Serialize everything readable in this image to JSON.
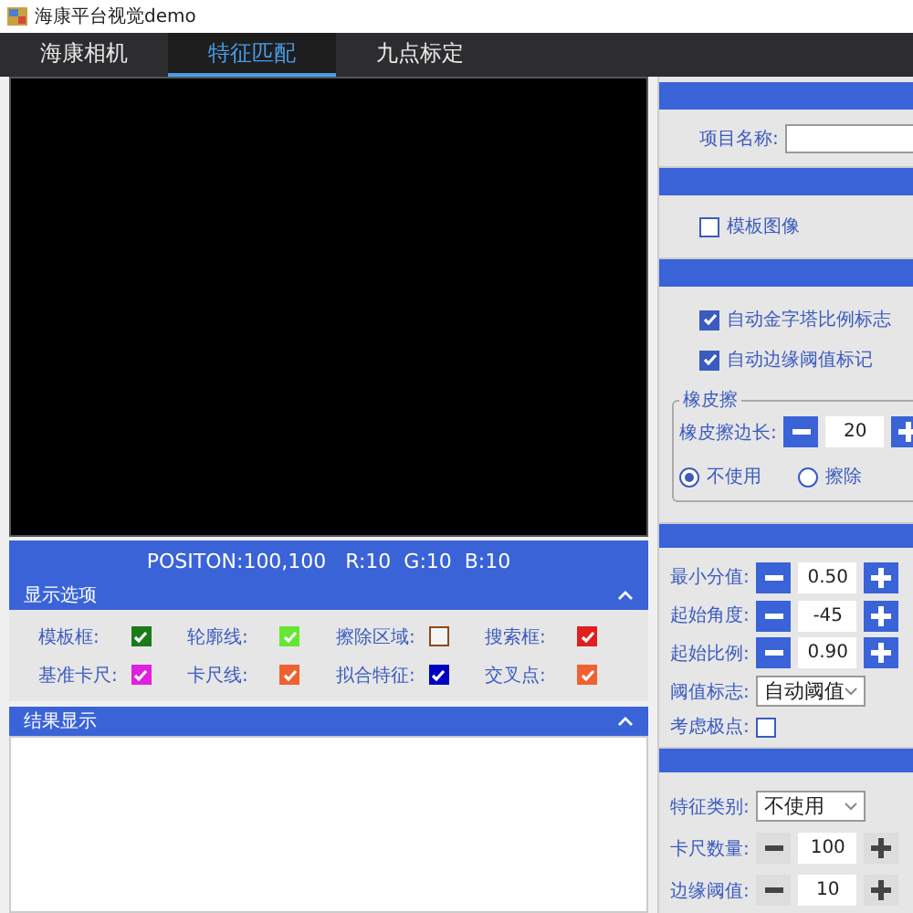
{
  "window": {
    "title": "海康平台视觉demo"
  },
  "tabs": [
    {
      "label": "海康相机",
      "selected": false
    },
    {
      "label": "特征匹配",
      "selected": true
    },
    {
      "label": "九点标定",
      "selected": false
    }
  ],
  "status_bar": {
    "text": "POSITON:100,100   R:10  G:10  B:10"
  },
  "display_options": {
    "title": "显示选项",
    "expanded": true,
    "items": [
      {
        "label": "模板框:",
        "checked": true,
        "color": "#1a7a1a"
      },
      {
        "label": "轮廓线:",
        "checked": true,
        "color": "#66e633"
      },
      {
        "label": "擦除区域:",
        "checked": false,
        "color": "#8b4a1a"
      },
      {
        "label": "搜索框:",
        "checked": true,
        "color": "#e02020"
      },
      {
        "label": "基准卡尺:",
        "checked": true,
        "color": "#e020e0"
      },
      {
        "label": "卡尺线:",
        "checked": true,
        "color": "#f06030"
      },
      {
        "label": "拟合特征:",
        "checked": true,
        "color": "#0000c0"
      },
      {
        "label": "交叉点:",
        "checked": true,
        "color": "#f06030"
      }
    ]
  },
  "results": {
    "title": "结果显示",
    "expanded": true
  },
  "right_panel": {
    "project_name": {
      "label": "项目名称:"
    },
    "template_image": {
      "label": "模板图像",
      "checked": false
    },
    "auto_checks": [
      {
        "label": "自动金字塔比例标志",
        "checked": true
      },
      {
        "label": "自动边缘阈值标记",
        "checked": true
      }
    ],
    "eraser": {
      "title": "橡皮擦",
      "stepper": {
        "label": "橡皮擦边长:",
        "value": "20"
      },
      "radios": [
        {
          "label": "不使用",
          "selected": true
        },
        {
          "label": "擦除",
          "selected": false
        }
      ]
    },
    "params": [
      {
        "kind": "stepper",
        "label": "最小分值:",
        "value": "0.50",
        "disabled": false
      },
      {
        "kind": "stepper",
        "label": "起始角度:",
        "value": "-45",
        "disabled": false
      },
      {
        "kind": "stepper",
        "label": "起始比例:",
        "value": "0.90",
        "disabled": false
      },
      {
        "kind": "select",
        "label": "阈值标志:",
        "value": "自动阈值"
      },
      {
        "kind": "check",
        "label": "考虑极点:",
        "checked": false
      }
    ],
    "features": [
      {
        "kind": "select",
        "label": "特征类别:",
        "value": "不使用"
      },
      {
        "kind": "stepper",
        "label": "卡尺数量:",
        "value": "100",
        "disabled": true
      },
      {
        "kind": "stepper",
        "label": "边缘阈值:",
        "value": "10",
        "disabled": true
      }
    ]
  }
}
